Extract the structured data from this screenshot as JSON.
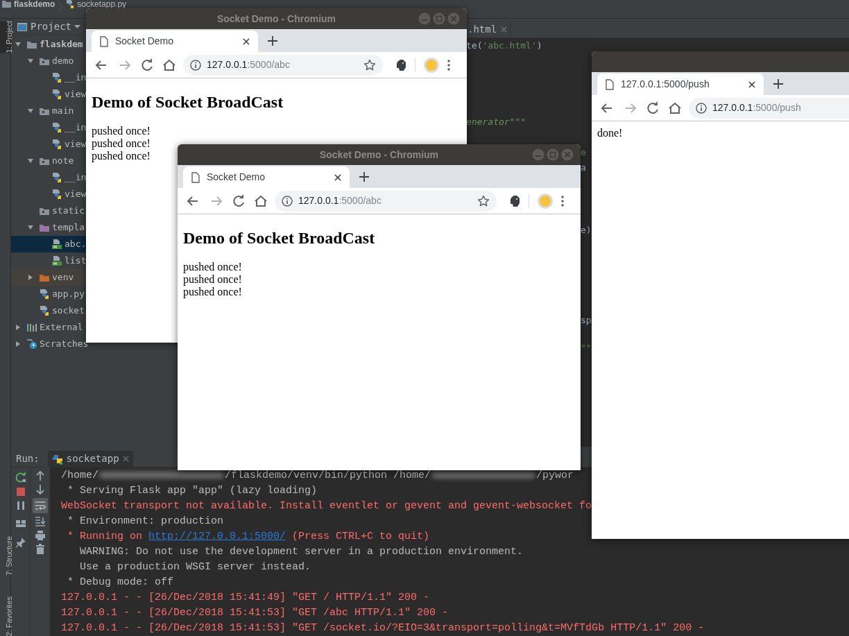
{
  "breadcrumb": [
    {
      "kind": "folder",
      "label": "flaskdemo"
    },
    {
      "kind": "python",
      "label": "socketapp.py"
    }
  ],
  "tool_strip": {
    "top": [
      {
        "label": "1: Project",
        "selected": true
      }
    ],
    "bottom": [
      {
        "label": "7: Structure",
        "selected": false
      },
      {
        "label": "2: Favorites",
        "selected": false
      }
    ]
  },
  "project_panel": {
    "title": "Project",
    "tree": [
      {
        "kind": "folder",
        "label": "flaskdem",
        "expanded": true,
        "selected": false,
        "children": [
          {
            "kind": "package",
            "label": "demo",
            "expanded": true,
            "selected": false,
            "children": [
              {
                "kind": "python",
                "label": "__in",
                "selected": false
              },
              {
                "kind": "python",
                "label": "view",
                "selected": false
              }
            ]
          },
          {
            "kind": "package",
            "label": "main",
            "expanded": true,
            "selected": false,
            "children": [
              {
                "kind": "python",
                "label": "__in",
                "selected": false
              },
              {
                "kind": "python",
                "label": "view",
                "selected": false
              }
            ]
          },
          {
            "kind": "package",
            "label": "note",
            "expanded": true,
            "selected": false,
            "children": [
              {
                "kind": "python",
                "label": "__in",
                "selected": false
              },
              {
                "kind": "python",
                "label": "view",
                "selected": false
              }
            ]
          },
          {
            "kind": "package",
            "label": "static",
            "selected": false
          },
          {
            "kind": "template",
            "label": "templa",
            "expanded": true,
            "selected": false,
            "children": [
              {
                "kind": "html",
                "label": "abc.",
                "selected": true
              },
              {
                "kind": "html",
                "label": "list",
                "selected": false
              }
            ]
          },
          {
            "kind": "excluded",
            "label": "venv",
            "expanded": false,
            "selected": false
          },
          {
            "kind": "python",
            "label": "app.py",
            "selected": false
          },
          {
            "kind": "python",
            "label": "socket",
            "selected": false
          }
        ]
      },
      {
        "kind": "library",
        "label": "External",
        "expanded": false,
        "selected": false
      },
      {
        "kind": "scratch",
        "label": "Scratches",
        "expanded": false,
        "selected": false
      }
    ]
  },
  "editor": {
    "tabs": [
      {
        "label": ".html",
        "selected": false
      }
    ],
    "code": [
      {
        "parts": [
          {
            "kind": "plain",
            "text": "te("
          },
          {
            "kind": "string",
            "text": "'abc.html'"
          },
          {
            "kind": "plain",
            "text": ")"
          }
        ]
      },
      {
        "parts": [
          {
            "kind": "docstring",
            "text": "enerator\"\"\""
          }
        ]
      },
      {
        "parts": [
          {
            "kind": "string",
            "text": "e"
          }
        ]
      },
      {
        "parts": [
          {
            "kind": "plain",
            "text": "a"
          }
        ]
      },
      {
        "parts": [
          {
            "kind": "plain",
            "text": "e)"
          }
        ]
      },
      {
        "parts": [
          {
            "kind": "plain",
            "text": "sp"
          }
        ]
      },
      {
        "parts": [
          {
            "kind": "docstring",
            "text": "\"\""
          }
        ]
      }
    ]
  },
  "run_panel": {
    "title": "Run:",
    "tabs": [
      {
        "label": "socketapp",
        "selected": true
      }
    ],
    "console": [
      {
        "kind": "redacted",
        "parts": [
          "/home/",
          "/flaskdemo/venv/bin/python /home/",
          "/pywor"
        ]
      },
      {
        "kind": "info",
        "text": " * Serving Flask app \"app\" (lazy loading)"
      },
      {
        "kind": "error",
        "text": "WebSocket transport not available. Install eventlet or gevent and gevent-websocket fo"
      },
      {
        "kind": "info",
        "text": " * Environment: production"
      },
      {
        "kind": "link",
        "before": " * Running on ",
        "link": "http://127.0.0.1:5000/",
        "after": " (Press CTRL+C to quit)"
      },
      {
        "kind": "info",
        "text": "   WARNING: Do not use the development server in a production environment."
      },
      {
        "kind": "info",
        "text": "   Use a production WSGI server instead."
      },
      {
        "kind": "info",
        "text": " * Debug mode: off"
      },
      {
        "kind": "error",
        "text": "127.0.0.1 - - [26/Dec/2018 15:41:49] \"GET / HTTP/1.1\" 200 -"
      },
      {
        "kind": "error",
        "text": "127.0.0.1 - - [26/Dec/2018 15:41:53] \"GET /abc HTTP/1.1\" 200 -"
      },
      {
        "kind": "error",
        "text": "127.0.0.1 - - [26/Dec/2018 15:41:53] \"GET /socket.io/?EIO=3&transport=polling&t=MVfTdGb HTTP/1.1\" 200 -"
      }
    ]
  },
  "browser_windows": [
    {
      "title": "Socket Demo - Chromium",
      "tabs": [
        {
          "label": "Socket Demo",
          "selected": true
        }
      ],
      "address": {
        "host": "127.0.0.1",
        "path": ":5000/abc"
      },
      "extras_visible": true,
      "page": {
        "heading": "Demo of Socket BroadCast",
        "lines": [
          "pushed once!",
          "pushed once!",
          "pushed once!"
        ]
      }
    },
    {
      "title": "Socket Demo - Chromium",
      "tabs": [
        {
          "label": "Socket Demo",
          "selected": true
        }
      ],
      "address": {
        "host": "127.0.0.1",
        "path": ":5000/abc"
      },
      "extras_visible": true,
      "page": {
        "heading": "Demo of Socket BroadCast",
        "lines": [
          "pushed once!",
          "pushed once!",
          "pushed once!"
        ]
      }
    },
    {
      "tabs": [
        {
          "label": "127.0.0.1:5000/push",
          "selected": true
        }
      ],
      "address": {
        "host": "127.0.0.1",
        "path": ":5000/push"
      },
      "extras_visible": false,
      "page": {
        "lines": [
          "done!"
        ]
      }
    }
  ]
}
